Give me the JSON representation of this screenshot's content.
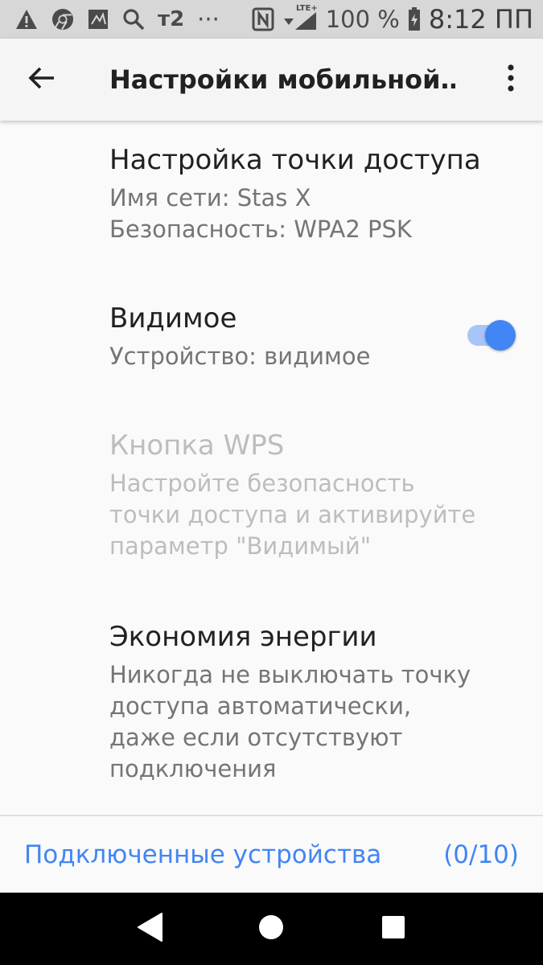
{
  "status_bar": {
    "carrier": "т2",
    "overflow": "···",
    "network": "LTE+",
    "battery": "100 %",
    "time": "8:12 ПП",
    "icons": [
      "warning-icon",
      "chrome-icon",
      "app-icon",
      "search-icon",
      "nfc-icon",
      "signal-icon",
      "battery-icon"
    ]
  },
  "app_bar": {
    "title": "Настройки мобильной…"
  },
  "prefs": {
    "ap_config": {
      "title": "Настройка точки доступа",
      "network_name": "Имя сети: Stas X",
      "security": "Безопасность: WPA2 PSK"
    },
    "visible": {
      "title": "Видимое",
      "summary": "Устройство: видимое",
      "enabled": true
    },
    "wps": {
      "title": "Кнопка WPS",
      "summary_line1": "Настройте безопасность",
      "summary_line2": "точки доступа и активируйте",
      "summary_line3": "параметр \"Видимый\"",
      "disabled": true
    },
    "power_saving": {
      "title": "Экономия энергии",
      "summary_line1": "Никогда не выключать точку",
      "summary_line2": "доступа автоматически,",
      "summary_line3": "даже если отсутствуют",
      "summary_line4": "подключения"
    }
  },
  "connected_devices": {
    "label": "Подключенные устройства",
    "count": "(0/10)"
  },
  "colors": {
    "accent": "#4285f4",
    "switch_track": "#a7c6f7",
    "disabled_text": "#bdbdbd",
    "secondary_text": "#757575",
    "status_bar_bg": "#d7d7d7",
    "nav_bar_bg": "#000000"
  }
}
